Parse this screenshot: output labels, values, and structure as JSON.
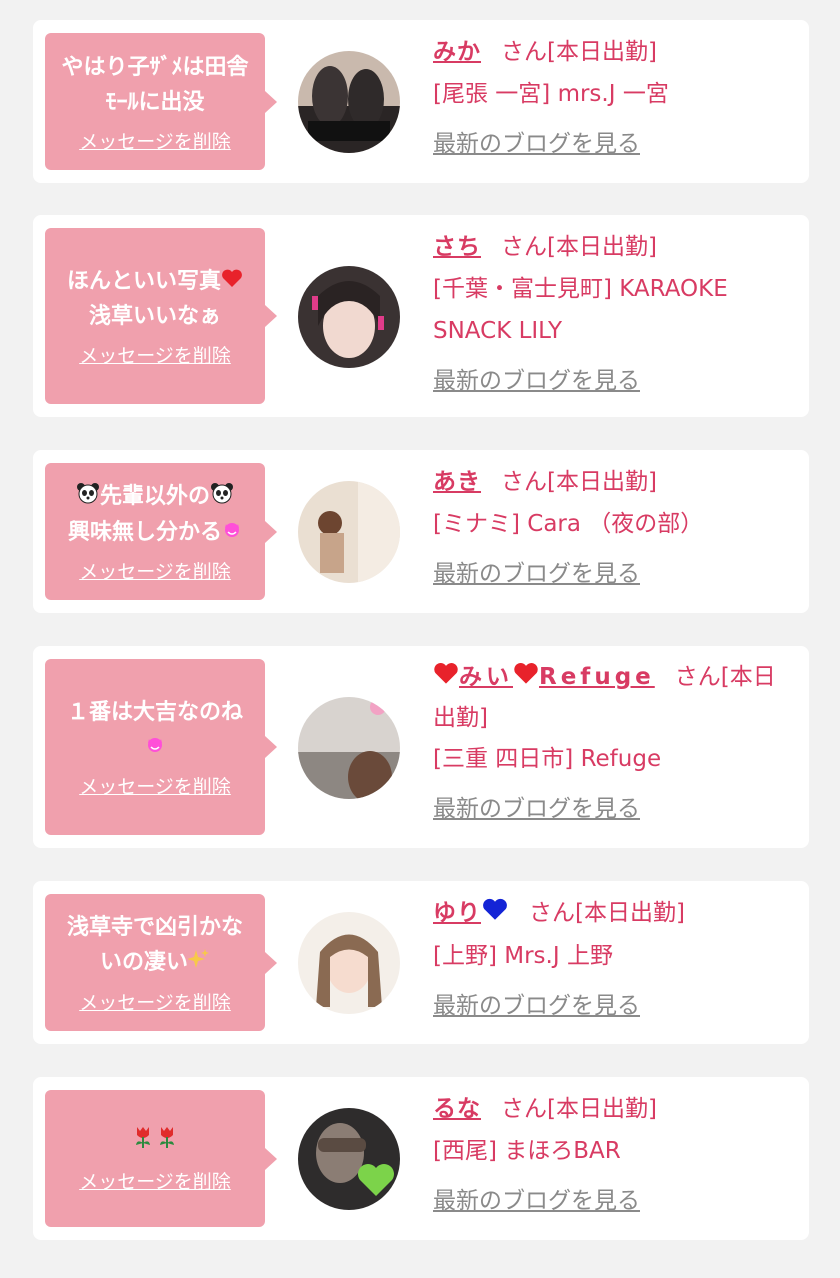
{
  "delete_label": "メッセージを削除",
  "blog_label": "最新のブログを見る",
  "colors": {
    "background": "#f2f2f2",
    "card": "#ffffff",
    "bubble": "#f0a0ad",
    "accent_text": "#d83b63",
    "link_gray": "#8a8a8a"
  },
  "items": [
    {
      "message": "やはり子ｻﾞﾒは田舎ﾓｰﾙに出没",
      "name": "みか",
      "status": "さん[本日出勤]",
      "shop": "[尾張 一宮] mrs.J 一宮"
    },
    {
      "message": "ほんといい写真",
      "message_line2": "浅草いいなぁ",
      "name": "さち",
      "status": "さん[本日出勤]",
      "shop": "[千葉・富士見町] KARAOKE SNACK LILY"
    },
    {
      "message": "先輩以外の",
      "message_line2": "興味無し分かる",
      "name": "あき",
      "status": "さん[本日出勤]",
      "shop": "[ミナミ] Cara （夜の部）"
    },
    {
      "message": "１番は大吉なのね",
      "name_part": "みい",
      "name_suffix": "Refuge",
      "status": "さん[本日出勤]",
      "shop": "[三重 四日市] Refuge"
    },
    {
      "message": "浅草寺で凶引かないの凄い",
      "name": "ゆり",
      "status": "さん[本日出勤]",
      "shop": "[上野] Mrs.J 上野"
    },
    {
      "message": "",
      "name": "るな",
      "status": "さん[本日出勤]",
      "shop": "[西尾] まほろBAR"
    }
  ]
}
